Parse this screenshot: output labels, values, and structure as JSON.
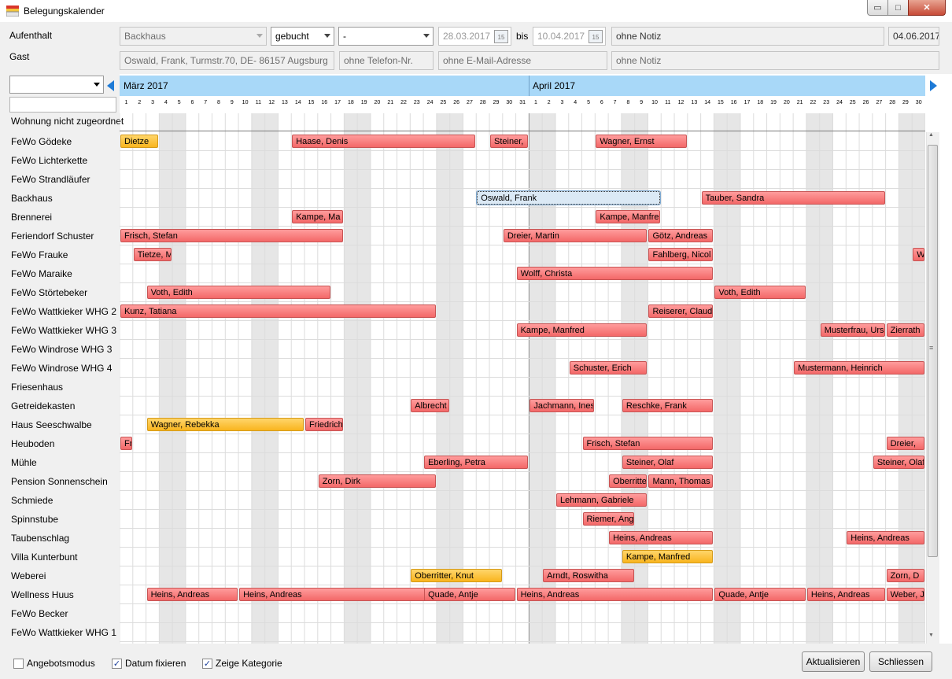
{
  "window": {
    "title": "Belegungskalender",
    "min_symbol": "▭",
    "max_symbol": "□",
    "close_symbol": "✕",
    "icon": "calendar-app-icon"
  },
  "form": {
    "aufenthalt_label": "Aufenthalt",
    "gast_label": "Gast",
    "unit": "Backhaus",
    "status": "gebucht",
    "category": "-",
    "date_from": "28.03.2017",
    "bis_label": "bis",
    "date_to": "10.04.2017",
    "calendar_icon_text": "15",
    "note_top": "ohne Notiz",
    "today": "04.06.2017",
    "guest_address": "Oswald, Frank, Turmstr.70, DE- 86157 Augsburg",
    "phone": "ohne Telefon-Nr.",
    "email": "ohne E-Mail-Adresse",
    "note_bottom": "ohne Notiz"
  },
  "filter": {
    "selected": "",
    "search": ""
  },
  "calendar": {
    "months": [
      "März 2017",
      "April 2017"
    ],
    "march_days": 31,
    "april_days": 30,
    "unassigned_label": "Wohnung nicht zugeordnet",
    "weekend_color": "#e6e6e6",
    "booked_color": "#f36868",
    "option_color": "#f9b51e",
    "rows": [
      {
        "name": "FeWo Gödeke",
        "bookings": [
          {
            "guest": "Dietze",
            "start": "2017-03-01",
            "end": "2017-03-03",
            "color": "orange"
          },
          {
            "guest": "Haase, Denis",
            "start": "2017-03-14",
            "end": "2017-03-27"
          },
          {
            "guest": "Steiner,",
            "start": "2017-03-29",
            "end": "2017-03-31"
          },
          {
            "guest": "Wagner, Ernst",
            "start": "2017-04-06",
            "end": "2017-04-12"
          }
        ]
      },
      {
        "name": "FeWo Lichterkette",
        "bookings": []
      },
      {
        "name": "FeWo Strandläufer",
        "bookings": []
      },
      {
        "name": "Backhaus",
        "bookings": [
          {
            "guest": "Oswald, Frank",
            "start": "2017-03-28",
            "end": "2017-04-10",
            "color": "selected"
          },
          {
            "guest": "Tauber, Sandra",
            "start": "2017-04-14",
            "end": "2017-04-27"
          }
        ]
      },
      {
        "name": "Brennerei",
        "bookings": [
          {
            "guest": "Kampe, Ma",
            "start": "2017-03-14",
            "end": "2017-03-17"
          },
          {
            "guest": "Kampe, Manfre",
            "start": "2017-04-06",
            "end": "2017-04-10"
          }
        ]
      },
      {
        "name": "Feriendorf Schuster",
        "bookings": [
          {
            "guest": "Frisch, Stefan",
            "start": "2017-03-01",
            "end": "2017-03-17"
          },
          {
            "guest": "Dreier, Martin",
            "start": "2017-03-30",
            "end": "2017-04-09"
          },
          {
            "guest": "Götz, Andreas",
            "start": "2017-04-10",
            "end": "2017-04-14"
          }
        ]
      },
      {
        "name": "FeWo Frauke",
        "bookings": [
          {
            "guest": "Tietze, M",
            "start": "2017-03-02",
            "end": "2017-03-04"
          },
          {
            "guest": "Fahlberg, Nicol",
            "start": "2017-04-10",
            "end": "2017-04-14"
          },
          {
            "guest": "Wagner",
            "start": "2017-04-30",
            "end": "2017-04-30"
          }
        ]
      },
      {
        "name": "FeWo Maraike",
        "bookings": [
          {
            "guest": "Wolff, Christa",
            "start": "2017-03-31",
            "end": "2017-04-14"
          }
        ]
      },
      {
        "name": "FeWo Störtebeker",
        "bookings": [
          {
            "guest": "Voth, Edith",
            "start": "2017-03-03",
            "end": "2017-03-16"
          },
          {
            "guest": "Voth, Edith",
            "start": "2017-04-15",
            "end": "2017-04-21"
          }
        ]
      },
      {
        "name": "FeWo Wattkieker WHG 2",
        "bookings": [
          {
            "guest": "Kunz, Tatiana",
            "start": "2017-03-01",
            "end": "2017-03-24"
          },
          {
            "guest": "Reiserer, Claudia",
            "start": "2017-04-10",
            "end": "2017-04-14"
          }
        ]
      },
      {
        "name": "FeWo Wattkieker WHG 3",
        "bookings": [
          {
            "guest": "Kampe, Manfred",
            "start": "2017-03-31",
            "end": "2017-04-09"
          },
          {
            "guest": "Musterfrau, Ursula",
            "start": "2017-04-23",
            "end": "2017-04-27"
          },
          {
            "guest": "Zierrath",
            "start": "2017-04-28",
            "end": "2017-04-30"
          }
        ]
      },
      {
        "name": "FeWo Windrose WHG 3",
        "bookings": []
      },
      {
        "name": "FeWo Windrose WHG 4",
        "bookings": [
          {
            "guest": "Schuster, Erich",
            "start": "2017-04-04",
            "end": "2017-04-09"
          },
          {
            "guest": "Mustermann, Heinrich",
            "start": "2017-04-21",
            "end": "2017-04-30"
          }
        ]
      },
      {
        "name": "Friesenhaus",
        "bookings": []
      },
      {
        "name": "Getreidekasten",
        "bookings": [
          {
            "guest": "Albrecht",
            "start": "2017-03-23",
            "end": "2017-03-25"
          },
          {
            "guest": "Jachmann, Ines",
            "start": "2017-04-01",
            "end": "2017-04-05"
          },
          {
            "guest": "Reschke, Frank",
            "start": "2017-04-08",
            "end": "2017-04-14"
          }
        ]
      },
      {
        "name": "Haus Seeschwalbe",
        "bookings": [
          {
            "guest": "Wagner, Rebekka",
            "start": "2017-03-03",
            "end": "2017-03-14",
            "color": "orange"
          },
          {
            "guest": "Friedrich",
            "start": "2017-03-15",
            "end": "2017-03-17"
          }
        ]
      },
      {
        "name": "Heuboden",
        "bookings": [
          {
            "guest": "Frisch",
            "start": "2017-03-01",
            "end": "2017-03-01"
          },
          {
            "guest": "Frisch, Stefan",
            "start": "2017-04-05",
            "end": "2017-04-14"
          },
          {
            "guest": "Dreier,",
            "start": "2017-04-28",
            "end": "2017-04-30"
          }
        ]
      },
      {
        "name": "Mühle",
        "bookings": [
          {
            "guest": "Eberling, Petra",
            "start": "2017-03-24",
            "end": "2017-03-31"
          },
          {
            "guest": "Steiner, Olaf",
            "start": "2017-04-08",
            "end": "2017-04-14"
          },
          {
            "guest": "Steiner, Olaf",
            "start": "2017-04-27",
            "end": "2017-04-30"
          }
        ]
      },
      {
        "name": "Pension Sonnenschein",
        "bookings": [
          {
            "guest": "Zorn, Dirk",
            "start": "2017-03-16",
            "end": "2017-03-24"
          },
          {
            "guest": "Oberritter",
            "start": "2017-04-07",
            "end": "2017-04-09"
          },
          {
            "guest": "Mann, Thomas",
            "start": "2017-04-10",
            "end": "2017-04-14"
          }
        ]
      },
      {
        "name": "Schmiede",
        "bookings": [
          {
            "guest": "Lehmann, Gabriele",
            "start": "2017-04-03",
            "end": "2017-04-09"
          }
        ]
      },
      {
        "name": "Spinnstube",
        "bookings": [
          {
            "guest": "Riemer, Angelika",
            "start": "2017-04-05",
            "end": "2017-04-08"
          }
        ]
      },
      {
        "name": "Taubenschlag",
        "bookings": [
          {
            "guest": "Heins, Andreas",
            "start": "2017-04-07",
            "end": "2017-04-14"
          },
          {
            "guest": "Heins, Andreas",
            "start": "2017-04-25",
            "end": "2017-04-30"
          }
        ]
      },
      {
        "name": "Villa Kunterbunt",
        "bookings": [
          {
            "guest": "Kampe, Manfred",
            "start": "2017-04-08",
            "end": "2017-04-14",
            "color": "orange"
          }
        ]
      },
      {
        "name": "Weberei",
        "bookings": [
          {
            "guest": "Oberritter, Knut",
            "start": "2017-03-23",
            "end": "2017-03-29",
            "color": "orange"
          },
          {
            "guest": "Arndt, Roswitha",
            "start": "2017-04-02",
            "end": "2017-04-08"
          },
          {
            "guest": "Zorn, D",
            "start": "2017-04-28",
            "end": "2017-04-30"
          }
        ]
      },
      {
        "name": "Wellness Huus",
        "bookings": [
          {
            "guest": "Heins, Andreas",
            "start": "2017-03-03",
            "end": "2017-03-09"
          },
          {
            "guest": "Heins, Andreas",
            "start": "2017-03-10",
            "end": "2017-03-24"
          },
          {
            "guest": "Quade, Antje",
            "start": "2017-03-24",
            "end": "2017-03-30"
          },
          {
            "guest": "Heins, Andreas",
            "start": "2017-03-31",
            "end": "2017-04-14"
          },
          {
            "guest": "Quade, Antje",
            "start": "2017-04-15",
            "end": "2017-04-21"
          },
          {
            "guest": "Heins, Andreas",
            "start": "2017-04-22",
            "end": "2017-04-27"
          },
          {
            "guest": "Weber, J",
            "start": "2017-04-28",
            "end": "2017-04-30"
          }
        ]
      },
      {
        "name": "FeWo Becker",
        "bookings": []
      },
      {
        "name": "FeWo Wattkieker WHG 1",
        "bookings": []
      }
    ]
  },
  "footer": {
    "angebotsmodus": {
      "label": "Angebotsmodus",
      "checked": false
    },
    "datum_fixieren": {
      "label": "Datum fixieren",
      "checked": true
    },
    "zeige_kategorie": {
      "label": "Zeige Kategorie",
      "checked": true
    },
    "refresh_label": "Aktualisieren",
    "close_label": "Schliessen",
    "check_mark": "✓"
  },
  "scroll": {
    "grip": "≡",
    "up": "▲",
    "down": "▼"
  }
}
